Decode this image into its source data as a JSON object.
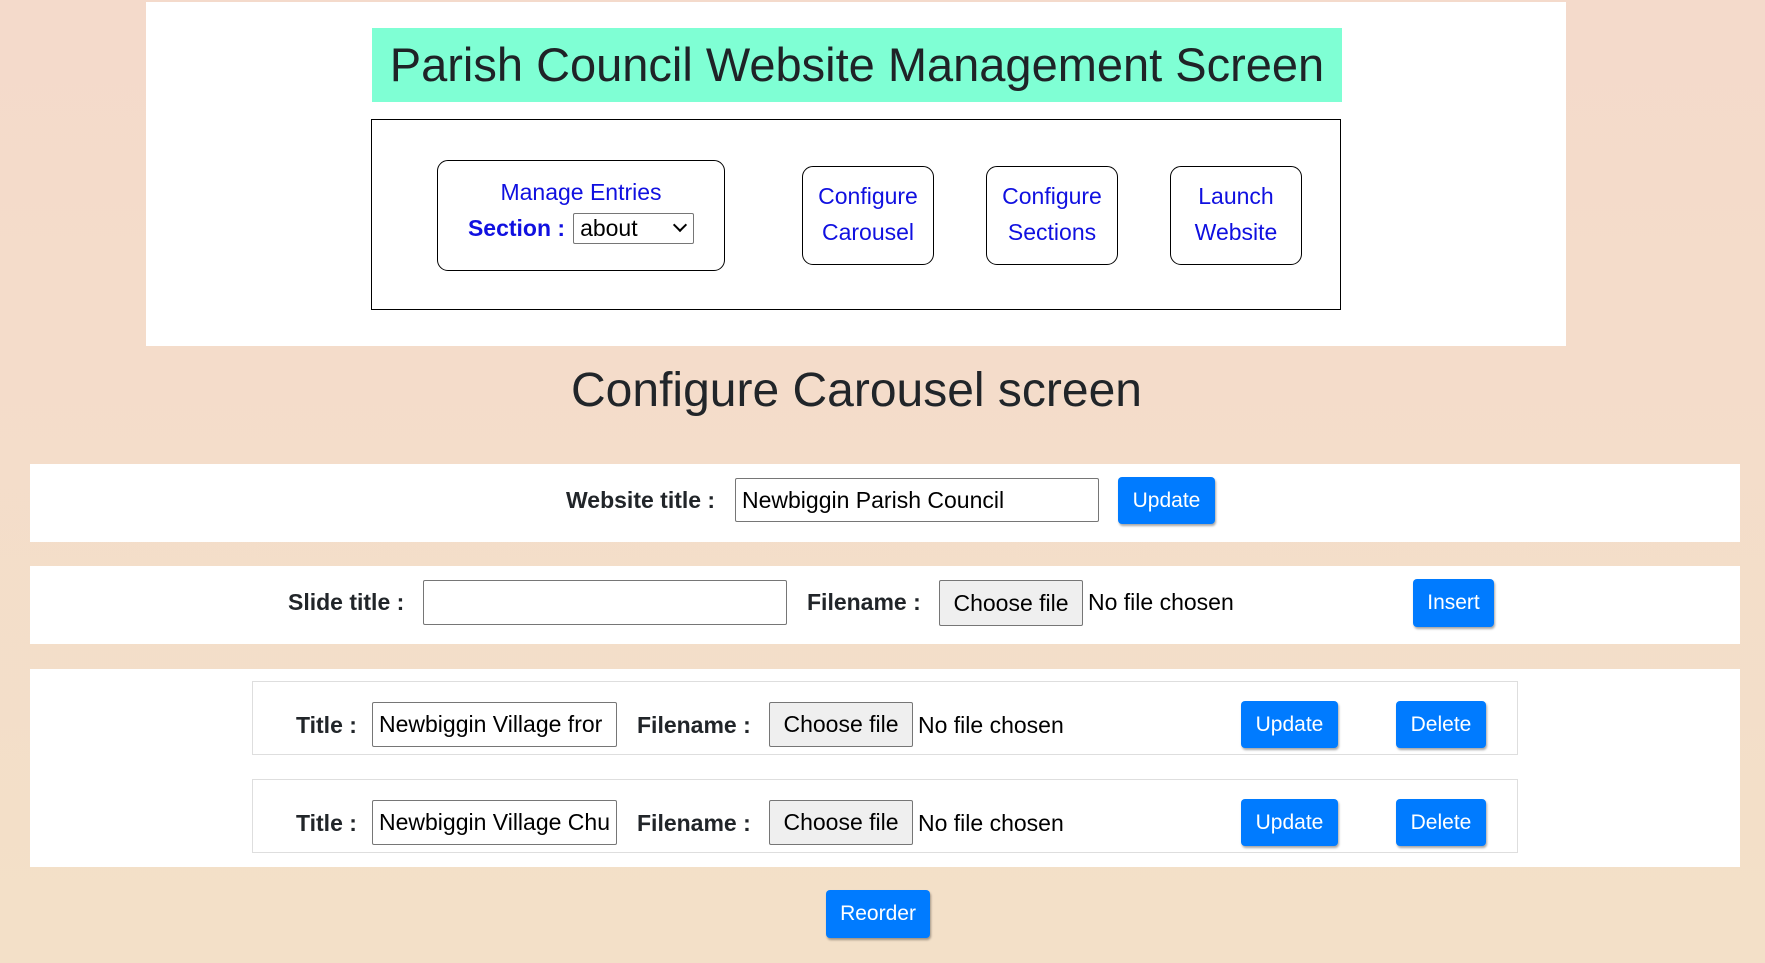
{
  "header": {
    "title": "Parish Council Website Management Screen"
  },
  "nav": {
    "manage_entries": {
      "label": "Manage Entries",
      "section_label": "Section :",
      "section_selected": "about"
    },
    "configure_carousel": {
      "line1": "Configure",
      "line2": "Carousel"
    },
    "configure_sections": {
      "line1": "Configure",
      "line2": "Sections"
    },
    "launch_website": {
      "line1": "Launch",
      "line2": "Website"
    }
  },
  "screen_title": "Configure Carousel screen",
  "website_title_form": {
    "label": "Website title :",
    "value": "Newbiggin Parish Council",
    "update_label": "Update"
  },
  "new_slide_form": {
    "title_label": "Slide title :",
    "title_value": "",
    "filename_label": "Filename :",
    "choose_file_label": "Choose file",
    "file_status": "No file chosen",
    "insert_label": "Insert"
  },
  "slides": [
    {
      "title_label": "Title :",
      "title_value": "Newbiggin Village fror",
      "filename_label": "Filename :",
      "choose_file_label": "Choose file",
      "file_status": "No file chosen",
      "update_label": "Update",
      "delete_label": "Delete"
    },
    {
      "title_label": "Title :",
      "title_value": "Newbiggin Village Chu",
      "filename_label": "Filename :",
      "choose_file_label": "Choose file",
      "file_status": "No file chosen",
      "update_label": "Update",
      "delete_label": "Delete"
    }
  ],
  "reorder_label": "Reorder",
  "colors": {
    "title_bg": "#7fffd4",
    "link_blue": "#1010e0",
    "button_blue": "#007bff",
    "page_bg": "#f4dacb"
  }
}
